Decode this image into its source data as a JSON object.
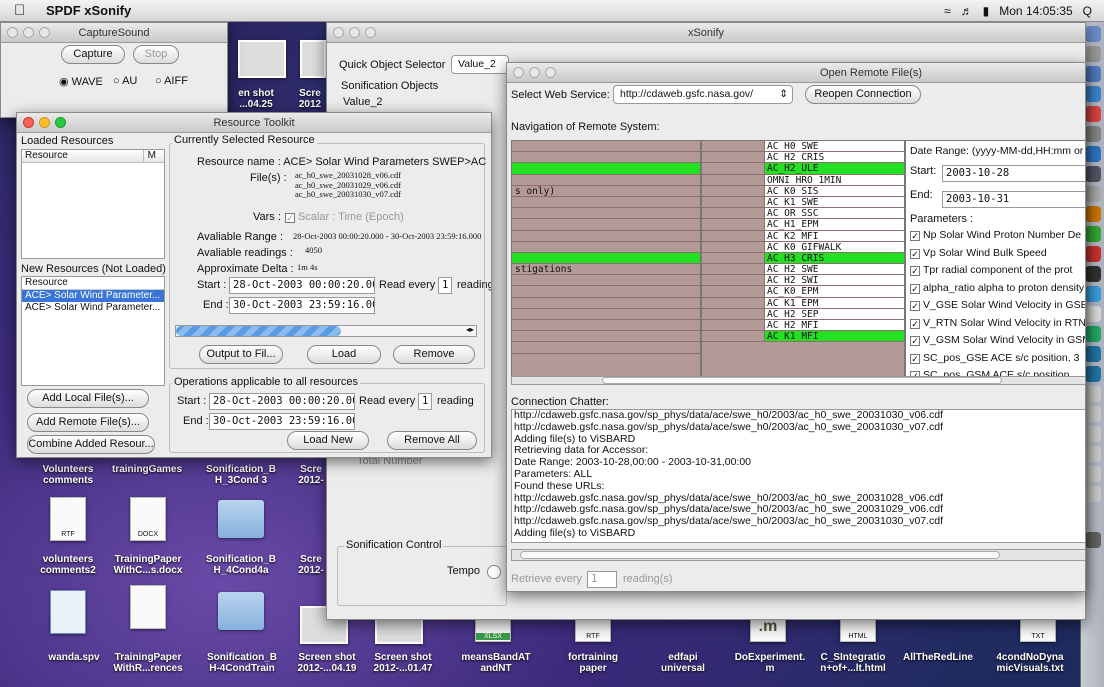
{
  "menubar": {
    "app": "SPDF xSonify",
    "clock": "Mon 14:05:35",
    "user": "Q"
  },
  "capture": {
    "title": "CaptureSound",
    "capture": "Capture",
    "stop": "Stop",
    "wave": "WAVE",
    "au": "AU",
    "aiff": "AIFF"
  },
  "xsonify": {
    "title": "xSonify",
    "qos_label": "Quick Object Selector",
    "qos_value": "Value_2",
    "son_objects": "Sonification Objects",
    "son_value": "Value_2",
    "son_control": "Sonification Control",
    "tempo": "Tempo",
    "total_number": "Total Number"
  },
  "toolkit": {
    "title": "Resource Toolkit",
    "loaded_title": "Loaded Resources",
    "col_resource": "Resource",
    "col_m": "M",
    "new_title": "New Resources (Not Loaded)",
    "new_items": [
      "Resource",
      "ACE> Solar Wind Parameter...",
      "ACE> Solar Wind Parameter..."
    ],
    "btn_add_local": "Add Local File(s)...",
    "btn_add_remote": "Add Remote File(s)...",
    "btn_combine": "Combine Added Resour...",
    "sel_title": "Currently Selected Resource",
    "name_label": "Resource name :",
    "name_value": "ACE> Solar Wind Parameters  SWEP>ACE S",
    "files_label": "File(s) :",
    "files": [
      "ac_h0_swe_20031028_v06.cdf",
      "ac_h0_swe_20031029_v06.cdf",
      "ac_h0_swe_20031030_v07.cdf"
    ],
    "vars_label": "Vars :",
    "vars_value": "Scalar : Time (Epoch)",
    "range_label": "Avaliable Range :",
    "range_value": "28-Oct-2003 00:00:20.000 - 30-Oct-2003 23:59:16.000",
    "readings_label": "Avaliable readings :",
    "readings_value": "4050",
    "delta_label": "Approximate Delta :",
    "delta_value": "1m 4s",
    "start_label": "Start :",
    "start_value": "28-Oct-2003 00:00:20.000",
    "read_every": "Read every",
    "read_n": "1",
    "reading": "reading",
    "end_label": "End :",
    "end_value": "30-Oct-2003 23:59:16.000",
    "btn_output": "Output to Fil...",
    "btn_load": "Load",
    "btn_remove": "Remove",
    "ops_title": "Operations applicable to all resources",
    "ops_start_value": "28-Oct-2003 00:00:20.000",
    "ops_end_value": "30-Oct-2003 23:59:16.000",
    "btn_load_new": "Load New",
    "btn_remove_all": "Remove All"
  },
  "remote": {
    "title": "Open Remote File(s)",
    "service_label": "Select Web Service:",
    "service_value": "http://cdaweb.gsfc.nasa.gov/",
    "btn_reopen": "Reopen Connection",
    "nav_label": "Navigation of Remote System:",
    "left_items": [
      "",
      "",
      "",
      "",
      "s only)",
      "",
      "",
      "",
      "",
      "",
      "",
      "stigations",
      "",
      "",
      "",
      "",
      "",
      "",
      ""
    ],
    "datasets": [
      "AC_H0_SWE",
      "AC_H2_CRIS",
      "AC_H2_ULE",
      "OMNI_HRO_1MIN",
      "AC_K0_SIS",
      "AC_K1_SWE",
      "AC_OR_SSC",
      "AC_H1_EPM",
      "AC_K2_MFI",
      "AC_K0_GIFWALK",
      "AC_H3_CRIS",
      "AC_H2_SWE",
      "AC_H2_SWI",
      "AC_K0_EPM",
      "AC_K1_EPM",
      "AC_H2_SEP",
      "AC_H2_MFI",
      "AC_K1_MFI"
    ],
    "date_range_label": "Date Range: (yyyy-MM-dd,HH:mm or",
    "start_label": "Start:",
    "start_value": "2003-10-28",
    "end_label": "End:",
    "end_value": "2003-10-31",
    "params_label": "Parameters :",
    "params": [
      "Np Solar Wind Proton Number De",
      "Vp Solar Wind Bulk Speed",
      "Tpr radial component of the prot",
      "alpha_ratio alpha to proton density",
      "V_GSE Solar Wind Velocity in GSE coo",
      "V_RTN Solar Wind Velocity in RTN co",
      "V_GSM Solar Wind Velocity in GSM c",
      "SC_pos_GSE ACE s/c position, 3",
      "SC_pos_GSM ACE s/c position"
    ],
    "chatter_label": "Connection Chatter:",
    "chatter": [
      "http://cdaweb.gsfc.nasa.gov/sp_phys/data/ace/swe_h0/2003/ac_h0_swe_20031030_v06.cdf",
      "http://cdaweb.gsfc.nasa.gov/sp_phys/data/ace/swe_h0/2003/ac_h0_swe_20031030_v07.cdf",
      "Adding file(s) to ViSBARD",
      "Retrieving data for Accessor:",
      "Date Range: 2003-10-28,00:00 - 2003-10-31,00:00",
      "Parameters: ALL",
      "Found these URLs:",
      "http://cdaweb.gsfc.nasa.gov/sp_phys/data/ace/swe_h0/2003/ac_h0_swe_20031028_v06.cdf",
      "http://cdaweb.gsfc.nasa.gov/sp_phys/data/ace/swe_h0/2003/ac_h0_swe_20031029_v06.cdf",
      "http://cdaweb.gsfc.nasa.gov/sp_phys/data/ace/swe_h0/2003/ac_h0_swe_20031030_v07.cdf",
      "Adding file(s) to ViSBARD"
    ],
    "retrieve_every": "Retrieve every",
    "retrieve_n": "1",
    "readings": "reading(s)"
  },
  "desktop": {
    "icons": [
      {
        "l1": "Volunteers",
        "l2": "comments"
      },
      {
        "l1": "trainingGames",
        "l2": ""
      },
      {
        "l1": "Sonification_B",
        "l2": "H_3Cond 3"
      },
      {
        "l1": "Scre",
        "l2": "2012-"
      },
      {
        "l1": "volunteers",
        "l2": "comments2"
      },
      {
        "l1": "TrainingPaper",
        "l2": "WithC...s.docx"
      },
      {
        "l1": "Sonification_B",
        "l2": "H_4Cond4a"
      },
      {
        "l1": "Scre",
        "l2": "2012-"
      },
      {
        "l1": "wanda.spv",
        "l2": ""
      },
      {
        "l1": "TrainingPaper",
        "l2": "WithR...rences"
      },
      {
        "l1": "Sonification_B",
        "l2": "H-4CondTrain"
      },
      {
        "l1": "Screen shot",
        "l2": "2012-...04.19"
      },
      {
        "l1": "Screen shot",
        "l2": "2012-...01.47"
      },
      {
        "l1": "meansBandAT",
        "l2": "andNT"
      },
      {
        "l1": "fortraining",
        "l2": "paper"
      },
      {
        "l1": "edfapi",
        "l2": "universal"
      },
      {
        "l1": "DoExperiment.",
        "l2": "m"
      },
      {
        "l1": "C_SIntegratio",
        "l2": "n+of+...lt.html"
      },
      {
        "l1": "AllTheRedLine",
        "l2": ""
      },
      {
        "l1": "4condNoDyna",
        "l2": "micVisuals.txt"
      }
    ],
    "top_icons": [
      {
        "l1": "en shot",
        "l2": "...04.25"
      },
      {
        "l1": "Scre",
        "l2": "2012"
      }
    ],
    "badges": {
      "rtf": "RTF",
      "docx": "DOCX",
      "xlsx": "XLSX",
      "html": "HTML",
      "txt": "TXT",
      "m": ".m"
    }
  }
}
